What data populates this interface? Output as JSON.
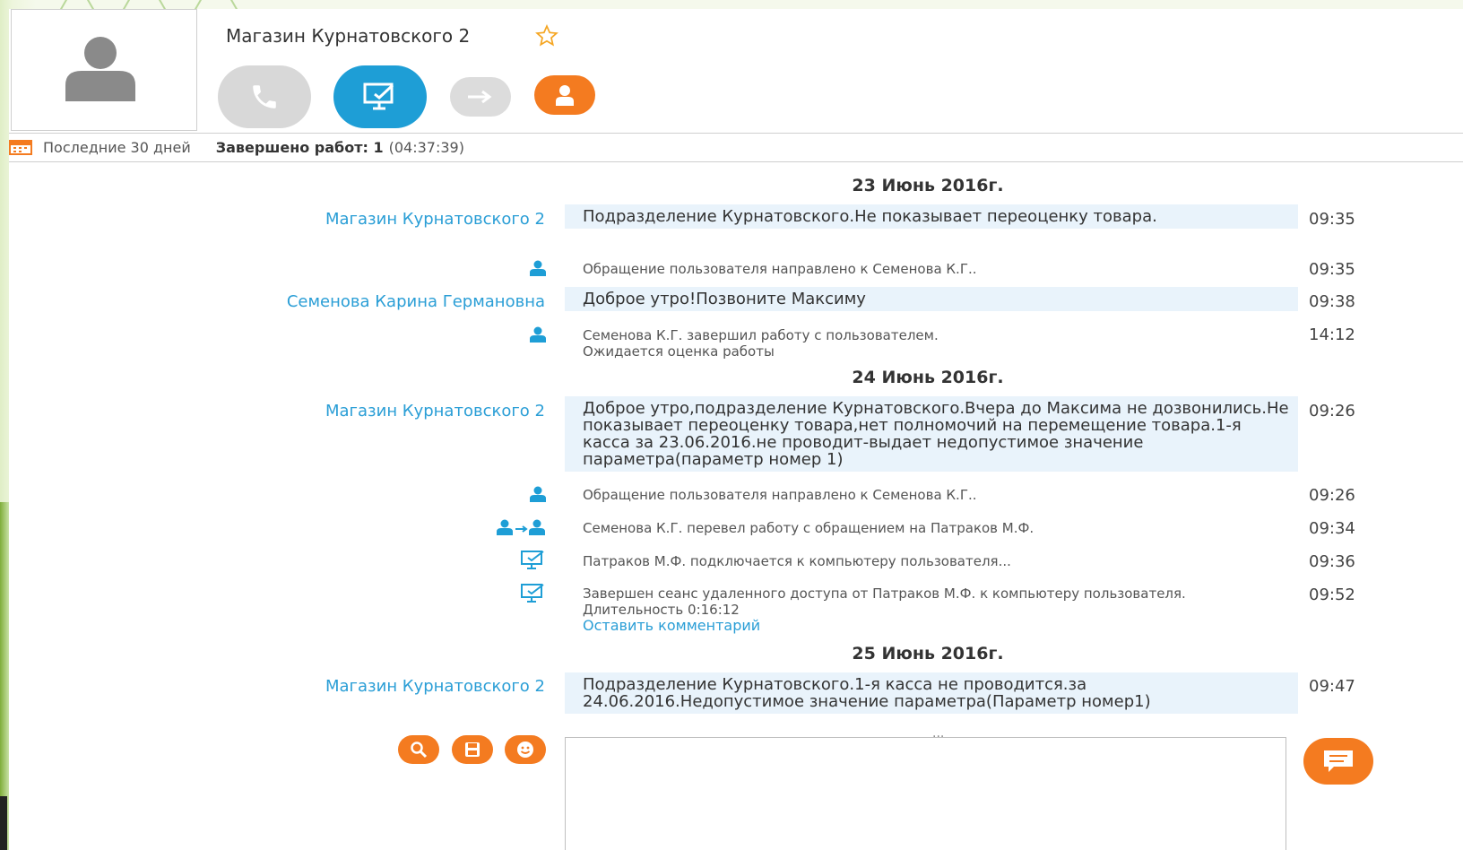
{
  "contact": {
    "name": "Магазин Курнатовского 2"
  },
  "stats": {
    "period": "Последние 30 дней",
    "completed_label": "Завершено работ: 1",
    "completed_time": "(04:37:39)"
  },
  "icons": {
    "avatar": "user-silhouette-icon",
    "favorite": "star-icon",
    "call": "phone-icon",
    "remote": "remote-desktop-icon",
    "transfer": "transfer-arrow-icon",
    "user": "user-icon",
    "calendar": "calendar-icon",
    "search": "search-icon",
    "save": "save-icon",
    "emoji": "smiley-icon",
    "send": "chat-bubble-icon"
  },
  "colors": {
    "accent_blue": "#1e9ed6",
    "accent_orange": "#f47b20",
    "link": "#2a9ed6",
    "bubble": "#e9f3fb"
  },
  "conversation": {
    "day1": {
      "date": "23 Июнь 2016г.",
      "m1": {
        "sender": "Магазин Курнатовского 2",
        "text": "Подразделение Курнатовского.Не показывает переоценку товара.",
        "time": "09:35"
      },
      "s1": {
        "text": "Обращение пользователя направлено к Семенова К.Г..",
        "time": "09:35"
      },
      "m2": {
        "sender": "Семенова Карина Германовна",
        "text": "Доброе утро!Позвоните Максиму",
        "time": "09:38"
      },
      "s2": {
        "text_line1": "Семенова К.Г. завершил работу с пользователем.",
        "text_line2": "Ожидается оценка работы",
        "time": "14:12"
      }
    },
    "day2": {
      "date": "24 Июнь 2016г.",
      "m1": {
        "sender": "Магазин Курнатовского 2",
        "text": "Доброе утро,подразделение Курнатовского.Вчера до Максима не дозвонились.Не показывает переоценку товара,нет полномочий на перемещение товара.1-я касса за 23.06.2016.не проводит-выдает недопустимое значение параметра(параметр номер 1)",
        "time": "09:26"
      },
      "s1": {
        "text": "Обращение пользователя направлено к Семенова К.Г..",
        "time": "09:26"
      },
      "s2": {
        "text": "Семенова К.Г. перевел работу с обращением на Патраков М.Ф.",
        "time": "09:34"
      },
      "s3": {
        "text": "Патраков М.Ф. подключается к компьютеру пользователя...",
        "time": "09:36"
      },
      "s4": {
        "text": "Завершен сеанс удаленного доступа от Патраков М.Ф. к компьютеру пользователя. Длительность 0:16:12",
        "link": "Оставить комментарий",
        "time": "09:52"
      }
    },
    "day3": {
      "date": "25 Июнь 2016г.",
      "m1": {
        "sender": "Магазин Курнатовского 2",
        "text": "Подразделение Курнатовского.1-я касса не проводится.за 24.06.2016.Недопустимое значение параметра(Параметр номер1)",
        "time": "09:47"
      }
    }
  },
  "composer": {
    "ellipsis": "...",
    "placeholder": ""
  }
}
